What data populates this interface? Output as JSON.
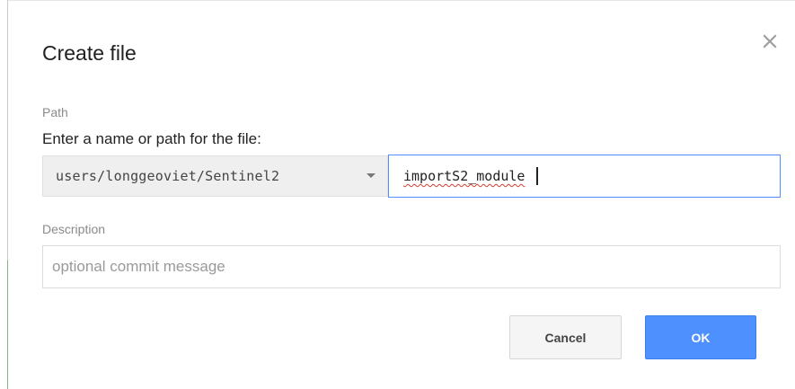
{
  "dialog": {
    "title": "Create file",
    "close_icon": "close-icon"
  },
  "path": {
    "section_label": "Path",
    "prompt": "Enter a name or path for the file:",
    "folder_value": "users/longgeoviet/Sentinel2",
    "folder_icon": "caret-down-icon",
    "filename_value": "importS2_module"
  },
  "description": {
    "section_label": "Description",
    "placeholder": "optional commit message"
  },
  "buttons": {
    "cancel_label": "Cancel",
    "ok_label": "OK"
  },
  "colors": {
    "accent": "#4d90fe",
    "spellcheck": "#d23f31"
  }
}
